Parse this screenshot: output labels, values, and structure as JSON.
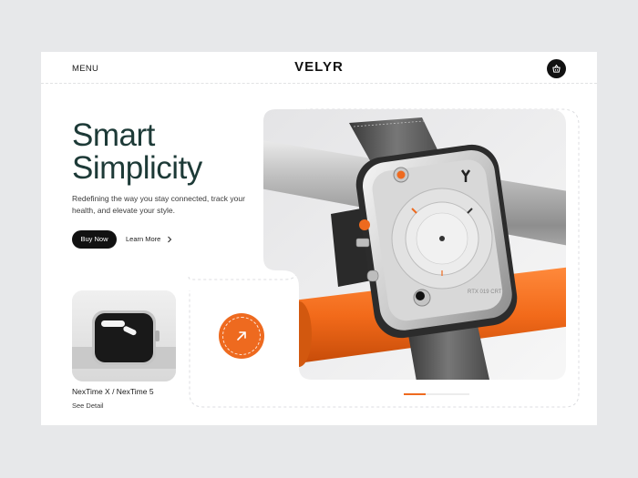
{
  "header": {
    "menu_label": "MENU",
    "brand": "VELYR",
    "cart_icon": "basket-icon"
  },
  "hero": {
    "title_line1": "Smart",
    "title_line2": "Simplicity",
    "description": "Redefining the way you stay connected, track your health, and elevate your style.",
    "buy_label": "Buy Now",
    "learn_label": "Learn More",
    "arrow_icon": "arrow-up-right-icon"
  },
  "product_card": {
    "name": "NexTime X / NexTime 5",
    "detail_label": "See Detail"
  },
  "watch_face_text": "RTX 019 CRT",
  "carousel": {
    "active_index": 0,
    "count": 3
  },
  "colors": {
    "accent": "#ee6a1f",
    "title": "#1d3a37",
    "dark": "#111111",
    "background": "#e7e8ea"
  }
}
